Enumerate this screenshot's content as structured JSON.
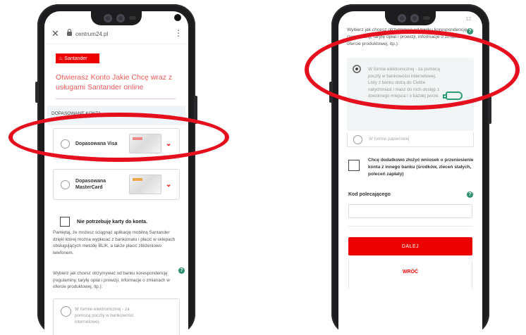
{
  "left_phone": {
    "browser": {
      "url": "centrum24.pl",
      "close_glyph": "✕",
      "menu_glyph": "⋮"
    },
    "logo_text": "Santander",
    "headline": "Otwierasz Konto Jakie Chcę wraz z usługami Santander online",
    "section_label": "DOPASOWANE KONTA",
    "cards": [
      {
        "label": "Dopasowana Visa",
        "chevron": "⌄"
      },
      {
        "label": "Dopasowana MasterCard",
        "chevron": "⌄"
      }
    ],
    "no_card_checkbox_label": "Nie potrzebuję karty do konta.",
    "info_paragraph": "Pamiętaj, że możesz ściągnąć aplikację mobilną Santander dzięki której można wypłacać z bankomatu i płacić w sklepach obsługujących metodę BLIK, a także płacić zbliżeniowo telefonem.",
    "correspondence_question": "Wybierz jak chcesz otrzymywać od banku korespondencję (regulaminy, taryfę opłat i prowizji, informacje o zmianach w ofercie produktowej, itp.):",
    "help_glyph": "?",
    "option_electronic_partial": "W formie elektronicznej - za pomocą poczty w bankowości internetowej."
  },
  "right_phone": {
    "status_text": "12:",
    "top_text": "Wybierz jak chcesz otrzymywać od banku korespondencję (regulaminy, taryfę opłat i prowizji, informacje o zmianach w ofercie produktowej, itp.):",
    "help_glyph": "?",
    "option_electronic": "W formie elektronicznej - za pomocą poczty w bankowości internetowej. Listy z banku dotrą do Ciebie natychmiast i masz do nich dostęp z dowolnego miejsca i o każdej porze.",
    "option_paper": "W formie papierowej",
    "transfer_checkbox_label": "Chcę dodatkowo złożyć wniosek o przeniesienie konta z innego banku (środków, zleceń stałych, poleceń zapłaty)",
    "referral_label": "Kod polecającego",
    "referral_value": "",
    "next_button": "DALEJ",
    "back_link": "WRÓĆ"
  },
  "colors": {
    "brand_red": "#ec0000",
    "highlight_red": "#e50f1d",
    "help_green": "#2e8f6f"
  }
}
